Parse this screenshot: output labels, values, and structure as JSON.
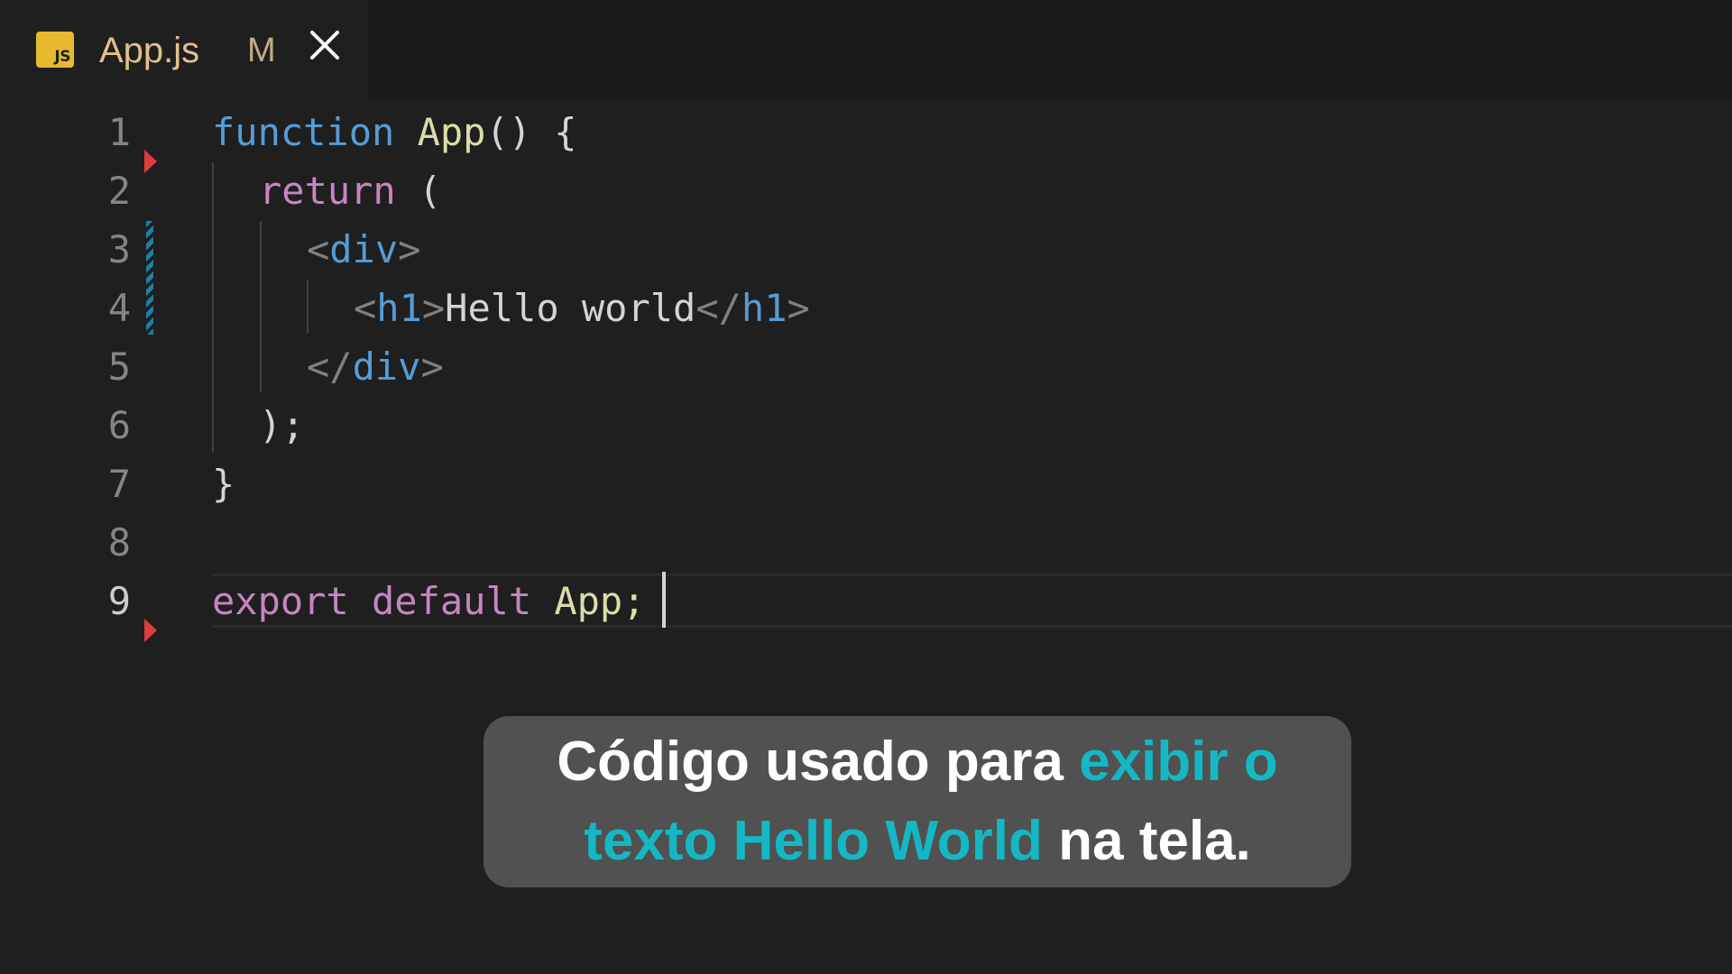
{
  "tab": {
    "icon_label": "JS",
    "title": "App.js",
    "status": "M",
    "close_glyph": "✕"
  },
  "gutter": {
    "line_numbers": [
      "1",
      "2",
      "3",
      "4",
      "5",
      "6",
      "7",
      "8",
      "9"
    ],
    "active_line": "9"
  },
  "code": {
    "line1": {
      "kw": "function",
      "name": "App",
      "rest": "() {"
    },
    "line2": {
      "kw": "return",
      "rest": "("
    },
    "line3": {
      "open": "<",
      "tag": "div",
      "close": ">"
    },
    "line4": {
      "open": "<",
      "tag": "h1",
      "close": ">",
      "text": "Hello world",
      "end_open": "</",
      "end_tag": "h1",
      "end_close": ">"
    },
    "line5": {
      "open": "</",
      "tag": "div",
      "close": ">"
    },
    "line6": {
      "text": ");"
    },
    "line7": {
      "text": "}"
    },
    "line9": {
      "kw1": "export",
      "kw2": "default",
      "name": "App;"
    }
  },
  "caption": {
    "part1": "Código usado para ",
    "highlight1": "exibir o",
    "highlight2": "texto Hello World",
    "part2": " na tela."
  },
  "colors": {
    "editor_background": "#1f1f1f",
    "keyword_blue": "#569cd6",
    "keyword_pink": "#c586c0",
    "function_yellow": "#dcdcaa",
    "modified_tab": "#e2c08d",
    "caption_highlight": "#14b8c4",
    "caption_background": "#515151"
  },
  "icons": [
    "js-file-icon",
    "close-icon",
    "diff-deleted-marker",
    "diff-modified-bar"
  ]
}
